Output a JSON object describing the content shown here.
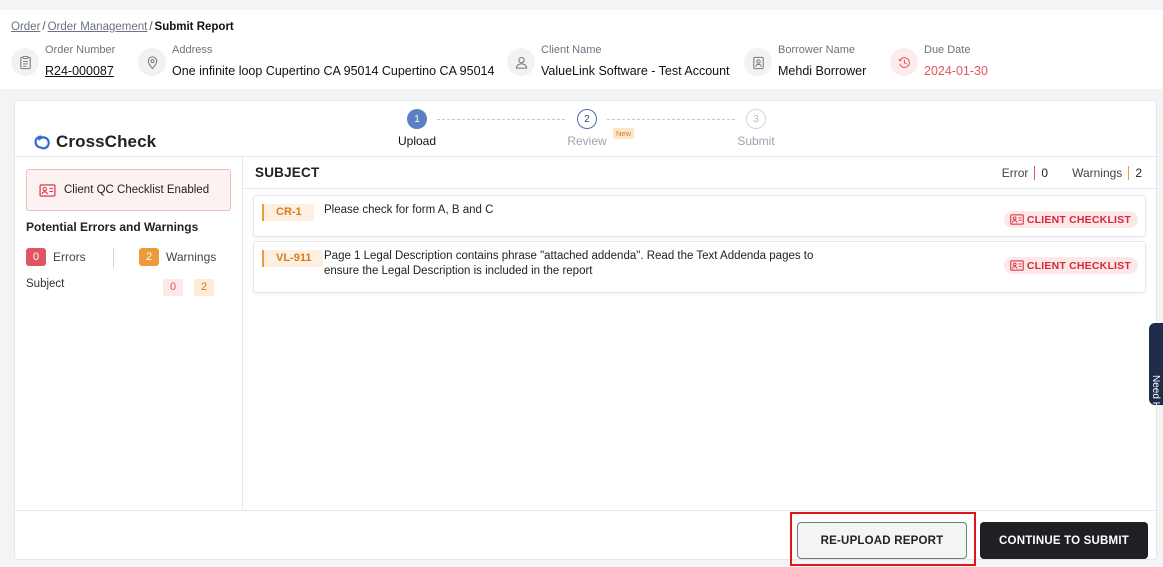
{
  "breadcrumb": {
    "items": [
      "Order",
      "Order Management"
    ],
    "current": "Submit Report"
  },
  "order_meta": {
    "order_number": {
      "label": "Order Number",
      "value": "R24-000087"
    },
    "address": {
      "label": "Address",
      "value": "One infinite loop Cupertino CA 95014 Cupertino CA 95014"
    },
    "client_name": {
      "label": "Client Name",
      "value": "ValueLink Software - Test Account"
    },
    "borrower_name": {
      "label": "Borrower Name",
      "value": "Mehdi Borrower"
    },
    "due_date": {
      "label": "Due Date",
      "value": "2024-01-30",
      "color": "#e05561"
    }
  },
  "logo": {
    "text": "CrossCheck",
    "icon": "crosscheck-logo-icon",
    "color": "#2b6cd4"
  },
  "stepper": {
    "steps": [
      {
        "number": "1",
        "label": "Upload",
        "state": "active"
      },
      {
        "number": "2",
        "label": "Review",
        "state": "current",
        "badge": "New"
      },
      {
        "number": "3",
        "label": "Submit",
        "state": "disabled"
      }
    ]
  },
  "sidebar": {
    "qc_notice": "Client QC Checklist Enabled",
    "title": "Potential Errors and Warnings",
    "errors_count": "0",
    "errors_label": "Errors",
    "warnings_count": "2",
    "warnings_label": "Warnings",
    "sections": [
      {
        "name": "Subject",
        "errors": "0",
        "warnings": "2"
      }
    ]
  },
  "main": {
    "section_title": "SUBJECT",
    "error_label": "Error",
    "error_count": "0",
    "warnings_label": "Warnings",
    "warnings_count": "2",
    "issues": [
      {
        "code": "CR-1",
        "description": "Please check for form A, B and C",
        "tag": "CLIENT CHECKLIST"
      },
      {
        "code": "VL-911",
        "description": "Page 1 Legal Description contains phrase \"attached addenda\". Read the Text Addenda pages to ensure the Legal Description is included in the report",
        "tag": "CLIENT CHECKLIST"
      }
    ]
  },
  "actions": {
    "reupload": "RE-UPLOAD REPORT",
    "continue": "CONTINUE TO SUBMIT"
  },
  "help_tab": "Need Help?"
}
